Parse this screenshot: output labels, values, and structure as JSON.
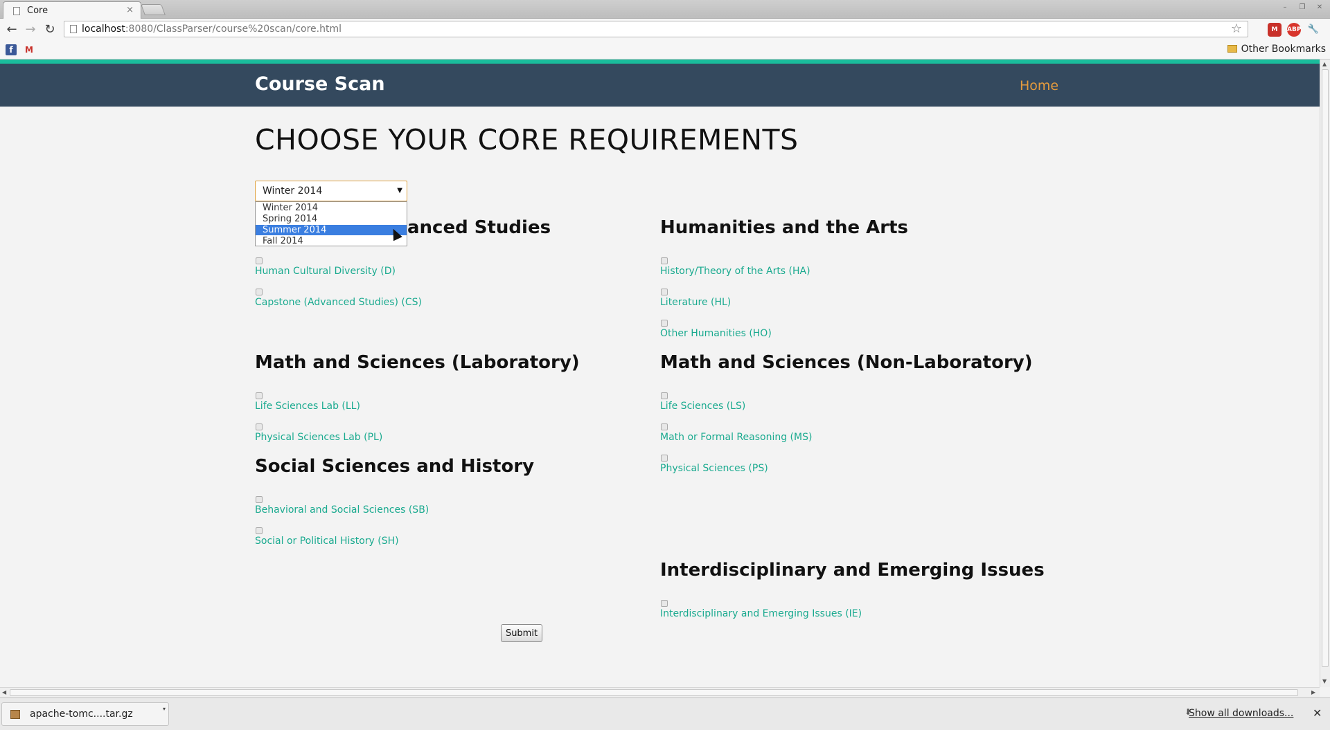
{
  "browser": {
    "tab_title": "Core",
    "tab_close": "×",
    "url_host": "localhost",
    "url_rest": ":8080/ClassParser/course%20scan/core.html",
    "other_bookmarks": "Other Bookmarks",
    "star": "☆",
    "back": "←",
    "forward": "→",
    "reload": "↻",
    "gmail_badge": "M",
    "abp": "ABP",
    "wrench": "🔧",
    "facebook": "f",
    "gmail_bm": "M",
    "win_min": "–",
    "win_max": "❐",
    "win_close": "✕"
  },
  "site": {
    "brand": "Course Scan",
    "nav_home": "Home",
    "page_title": "CHOOSE YOUR CORE REQUIREMENTS",
    "submit_label": "Submit"
  },
  "term_select": {
    "selected": "Winter 2014",
    "arrow": "▼",
    "options": [
      "Winter 2014",
      "Spring 2014",
      "Summer 2014",
      "Fall 2014"
    ],
    "highlighted": "Summer 2014"
  },
  "sections": {
    "diversity": {
      "title_visible": "anced Studies",
      "items": [
        "Human Cultural Diversity (D)",
        "Capstone (Advanced Studies) (CS)"
      ]
    },
    "humanities": {
      "title": "Humanities and the Arts",
      "items": [
        "History/Theory of the Arts (HA)",
        "Literature (HL)",
        "Other Humanities (HO)"
      ]
    },
    "math_lab": {
      "title": "Math and Sciences (Laboratory)",
      "items": [
        "Life Sciences Lab (LL)",
        "Physical Sciences Lab (PL)"
      ]
    },
    "math_nonlab": {
      "title": "Math and Sciences (Non-Laboratory)",
      "items": [
        "Life Sciences (LS)",
        "Math or Formal Reasoning (MS)",
        "Physical Sciences (PS)"
      ]
    },
    "social": {
      "title": "Social Sciences and History",
      "items": [
        "Behavioral and Social Sciences (SB)",
        "Social or Political History (SH)"
      ]
    },
    "interdisciplinary": {
      "title": "Interdisciplinary and Emerging Issues",
      "items": [
        "Interdisciplinary and Emerging Issues (IE)"
      ]
    }
  },
  "downloads": {
    "file": "apache-tomc....tar.gz",
    "menu": "▾",
    "show_all": "Show all downloads...",
    "icon": "⬇",
    "close": "✕"
  },
  "scroll": {
    "up": "▲",
    "down": "▼",
    "left": "◀",
    "right": "▶"
  }
}
